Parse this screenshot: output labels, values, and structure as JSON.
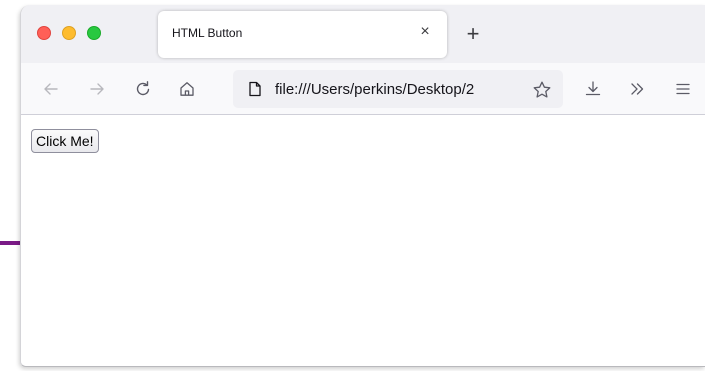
{
  "browser": {
    "tab": {
      "title": "HTML Button",
      "close_glyph": "×"
    },
    "new_tab_glyph": "+",
    "address_bar": {
      "url": "file:///Users/perkins/Desktop/2"
    }
  },
  "toolbar_icons": [
    "back-arrow-icon",
    "forward-arrow-icon",
    "reload-icon",
    "home-icon",
    "page-icon",
    "bookmark-star-icon",
    "download-icon",
    "overflow-chevrons-icon",
    "menu-hamburger-icon"
  ],
  "page": {
    "button_label": "Click Me!"
  },
  "colors": {
    "close": "#ff5f57",
    "minimize": "#febc2e",
    "maximize": "#28c840",
    "accent_line": "#7a1a86"
  }
}
